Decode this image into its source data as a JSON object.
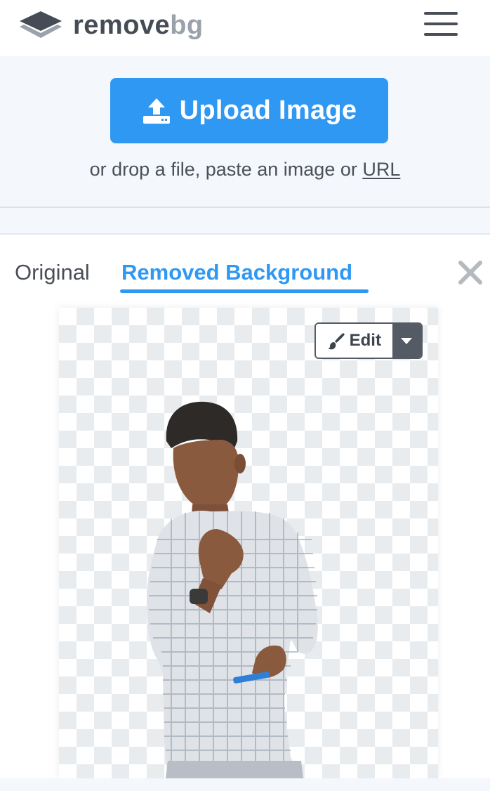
{
  "header": {
    "logo": {
      "word1": "remove",
      "word2": "bg",
      "icon": "layers-logo-icon"
    },
    "menu_icon": "hamburger-menu-icon"
  },
  "upload": {
    "button_label": "Upload Image",
    "button_icon": "upload-icon",
    "hint_prefix": "or drop a file, paste an image or ",
    "hint_link": "URL"
  },
  "tabs": [
    {
      "label": "Original",
      "active": false
    },
    {
      "label": "Removed Background",
      "active": true
    }
  ],
  "close_icon": "close-icon",
  "preview": {
    "edit_label": "Edit",
    "edit_icon": "brush-icon",
    "dropdown_icon": "caret-down-icon"
  },
  "colors": {
    "accent": "#2f98f3",
    "dark_text": "#454c55",
    "muted_logo": "#9aa1aa",
    "band_bg": "#f4f7fb",
    "edit_dark": "#545b64"
  }
}
